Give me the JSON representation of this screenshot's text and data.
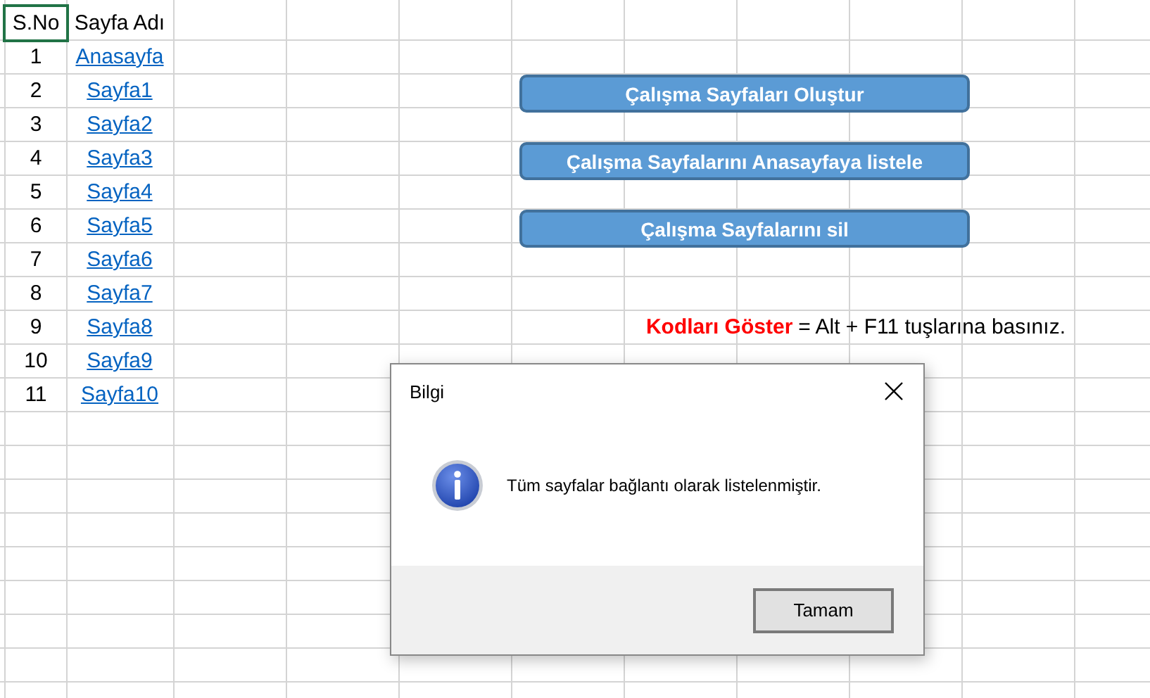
{
  "sheet": {
    "header": [
      {
        "text": "S.No",
        "selected": true
      },
      {
        "text": "Sayfa Adı",
        "selected": false
      }
    ],
    "rows": [
      {
        "no": "1",
        "link": "Anasayfa"
      },
      {
        "no": "2",
        "link": "Sayfa1"
      },
      {
        "no": "3",
        "link": "Sayfa2"
      },
      {
        "no": "4",
        "link": "Sayfa3"
      },
      {
        "no": "5",
        "link": "Sayfa4"
      },
      {
        "no": "6",
        "link": "Sayfa5"
      },
      {
        "no": "7",
        "link": "Sayfa6"
      },
      {
        "no": "8",
        "link": "Sayfa7"
      },
      {
        "no": "9",
        "link": "Sayfa8"
      },
      {
        "no": "10",
        "link": "Sayfa9"
      },
      {
        "no": "11",
        "link": "Sayfa10"
      }
    ]
  },
  "buttons": [
    "Çalışma Sayfaları Oluştur",
    "Çalışma Sayfalarını Anasayfaya listele",
    "Çalışma Sayfalarını sil"
  ],
  "note": {
    "label": "Kodları Göster",
    "text": "= Alt + F11 tuşlarına basınız."
  },
  "dialog": {
    "title": "Bilgi",
    "message": "Tüm sayfalar bağlantı olarak listelenmiştir.",
    "button": "Tamam"
  }
}
